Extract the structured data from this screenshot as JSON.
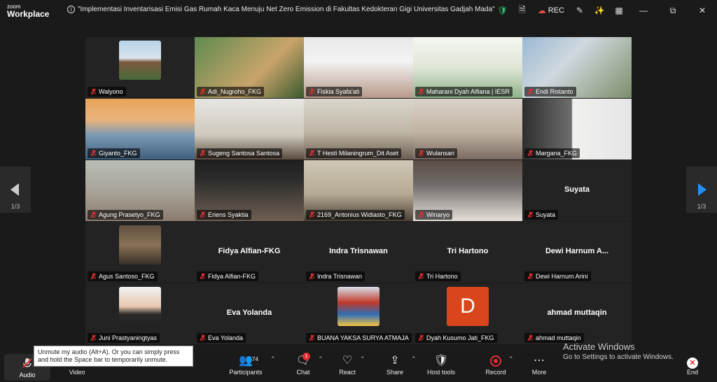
{
  "app": {
    "logo_line1": "zoom",
    "logo_line2": "Workplace"
  },
  "meeting_title": "\"Implementasi Inventarisasi Emisi Gas Rumah Kaca Menuju Net Zero Emission di  Fakultas Kedokteran Gigi Universitas Gadjah Mada\"",
  "titlebar": {
    "rec_label": "REC"
  },
  "pagination": {
    "left": "1/3",
    "right": "1/3"
  },
  "participants": [
    {
      "name": "Walyono",
      "kind": "avatar"
    },
    {
      "name": "Adi_Nugroho_FKG",
      "kind": "video"
    },
    {
      "name": "Fiskia Syafa'ati",
      "kind": "video",
      "speaking": true
    },
    {
      "name": "Maharani Dyah Alfiana | IESR",
      "kind": "video"
    },
    {
      "name": "Endi Ristanto",
      "kind": "video"
    },
    {
      "name": "Giyanto_FKG",
      "kind": "video"
    },
    {
      "name": "Sugeng Santosa Santosa",
      "kind": "video"
    },
    {
      "name": "T Hesti Milaningrum_Dit Aset",
      "kind": "video"
    },
    {
      "name": "Wulansari",
      "kind": "video"
    },
    {
      "name": "Margana_FKG",
      "kind": "video"
    },
    {
      "name": "Agung Prasetyo_FKG",
      "kind": "video"
    },
    {
      "name": "Eriens Syaktia",
      "kind": "video"
    },
    {
      "name": "2169_Antonius Widiasto_FKG",
      "kind": "video"
    },
    {
      "name": "Winaryo",
      "kind": "video"
    },
    {
      "name": "Suyata",
      "kind": "text",
      "display": "Suyata"
    },
    {
      "name": "Agus Santoso_FKG",
      "kind": "avatar"
    },
    {
      "name": "Fidya Alfian-FKG",
      "kind": "text",
      "display": "Fidya Alfian-FKG"
    },
    {
      "name": "Indra Trisnawan",
      "kind": "text",
      "display": "Indra Trisnawan"
    },
    {
      "name": "Tri Hartono",
      "kind": "text",
      "display": "Tri Hartono"
    },
    {
      "name": "Dewi Harnum Arini",
      "kind": "text",
      "display": "Dewi Harnum A..."
    },
    {
      "name": "Juni Prastyaningtyas",
      "kind": "avatar"
    },
    {
      "name": "Eva Yolanda",
      "kind": "text",
      "display": "Eva Yolanda"
    },
    {
      "name": "BUANA YAKSA SURYA ATMAJA",
      "kind": "avatar"
    },
    {
      "name": "Dyah Kusumo Jati_FKG",
      "kind": "letter",
      "letter": "D"
    },
    {
      "name": "ahmad muttaqin",
      "kind": "text",
      "display": "ahmad muttaqin"
    }
  ],
  "toolbar": {
    "audio": "Audio",
    "video": "Video",
    "participants": "Participants",
    "participants_count": "74",
    "chat": "Chat",
    "chat_badge": "1",
    "react": "React",
    "share": "Share",
    "host_tools": "Host tools",
    "record": "Record",
    "more": "More",
    "end": "End"
  },
  "tooltip": "Unmute my audio (Alt+A). Or you can simply press and hold the Space bar to temporarily unmute.",
  "watermark": {
    "line1": "Activate Windows",
    "line2": "Go to Settings to activate Windows."
  },
  "colors": {
    "speaking_border": "#2ecc71",
    "muted_icon": "#e02f2f",
    "letter_avatar": "#d9461c",
    "nav_active": "#1e90ff"
  }
}
